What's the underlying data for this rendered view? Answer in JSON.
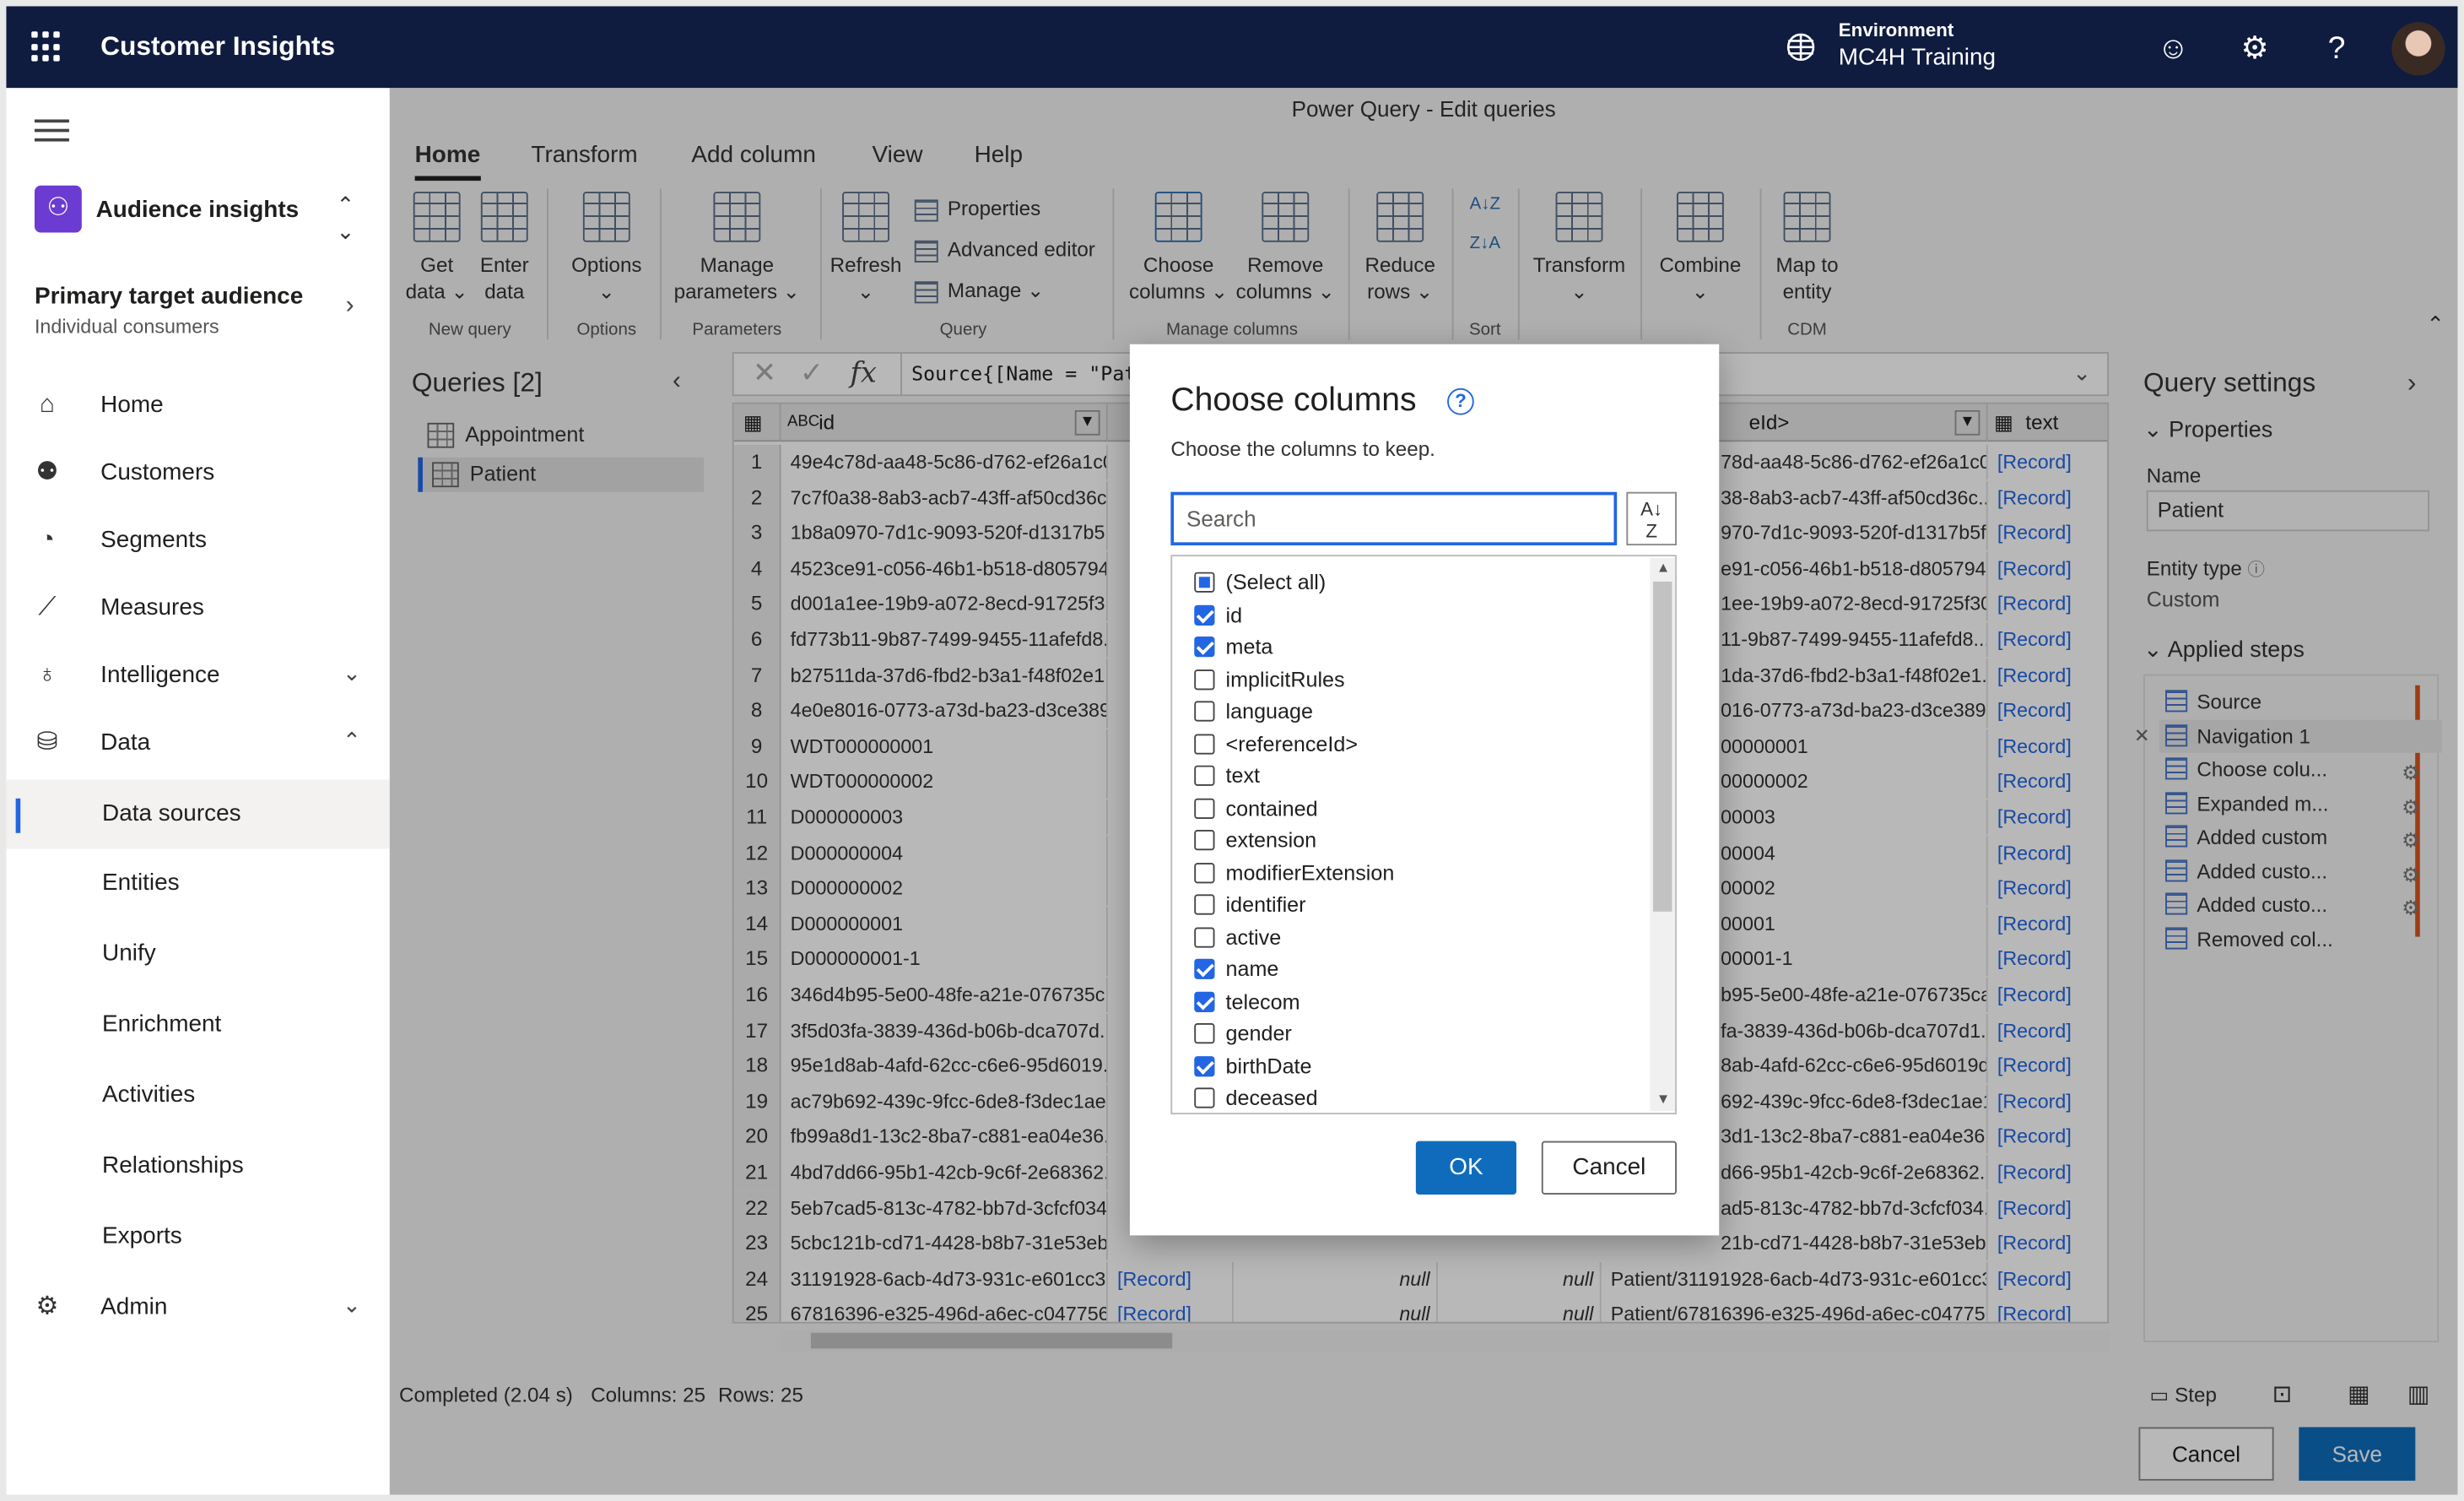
{
  "topbar": {
    "app_name": "Customer Insights",
    "env_label": "Environment",
    "env_value": "MC4H Training",
    "icons": [
      "waffle-icon",
      "environment-icon",
      "smiley-icon",
      "gear-icon",
      "help-icon",
      "avatar"
    ]
  },
  "sidebar": {
    "app": "Audience insights",
    "audience_title": "Primary target audience",
    "audience_sub": "Individual consumers",
    "items": [
      {
        "label": "Home",
        "icon": "home-icon"
      },
      {
        "label": "Customers",
        "icon": "customers-icon"
      },
      {
        "label": "Segments",
        "icon": "segments-icon"
      },
      {
        "label": "Measures",
        "icon": "measures-icon"
      },
      {
        "label": "Intelligence",
        "icon": "bulb-icon"
      },
      {
        "label": "Data",
        "icon": "data-icon"
      }
    ],
    "subitems": [
      "Data sources",
      "Entities",
      "Unify",
      "Enrichment",
      "Activities",
      "Relationships",
      "Exports"
    ],
    "admin": "Admin"
  },
  "pq": {
    "title": "Power Query - Edit queries",
    "tabs": [
      "Home",
      "Transform",
      "Add column",
      "View",
      "Help"
    ],
    "ribbon": {
      "get_data": [
        "Get",
        "data"
      ],
      "enter_data": [
        "Enter",
        "data"
      ],
      "new_query": "New query",
      "options": "Options",
      "options_grp": "Options",
      "manage_params": [
        "Manage",
        "parameters"
      ],
      "params_grp": "Parameters",
      "refresh": "Refresh",
      "properties": "Properties",
      "advanced_editor": "Advanced editor",
      "manage": "Manage",
      "query_grp": "Query",
      "choose_columns": [
        "Choose",
        "columns"
      ],
      "remove_columns": [
        "Remove",
        "columns"
      ],
      "manage_cols_grp": "Manage columns",
      "reduce_rows": [
        "Reduce",
        "rows"
      ],
      "sort_grp": "Sort",
      "transform": "Transform",
      "combine": "Combine",
      "map_entity": [
        "Map to",
        "entity"
      ],
      "cdm_grp": "CDM"
    },
    "queries": {
      "title": "Queries [2]",
      "items": [
        "Appointment",
        "Patient"
      ]
    },
    "formula": "Source{[Name = \"Pat",
    "columns": {
      "c1": "id",
      "c2": "eId>",
      "c3": "text"
    },
    "rows": [
      [
        "1",
        "49e4c78d-aa48-5c86-d762-ef26a1c0...",
        "78d-aa48-5c86-d762-ef26a1c0...",
        "[Record]"
      ],
      [
        "2",
        "7c7f0a38-8ab3-acb7-43ff-af50cd36c...",
        "38-8ab3-acb7-43ff-af50cd36c...",
        "[Record]"
      ],
      [
        "3",
        "1b8a0970-7d1c-9093-520f-d1317b5...",
        "970-7d1c-9093-520f-d1317b5f...",
        "[Record]"
      ],
      [
        "4",
        "4523ce91-c056-46b1-b518-d805794...",
        "e91-c056-46b1-b518-d805794f...",
        "[Record]"
      ],
      [
        "5",
        "d001a1ee-19b9-a072-8ecd-91725f3...",
        "1ee-19b9-a072-8ecd-91725f30...",
        "[Record]"
      ],
      [
        "6",
        "fd773b11-9b87-7499-9455-11afefd8...",
        "11-9b87-7499-9455-11afefd8...",
        "[Record]"
      ],
      [
        "7",
        "b27511da-37d6-fbd2-b3a1-f48f02e1...",
        "1da-37d6-fbd2-b3a1-f48f02e1...",
        "[Record]"
      ],
      [
        "8",
        "4e0e8016-0773-a73d-ba23-d3ce389...",
        "016-0773-a73d-ba23-d3ce389...",
        "[Record]"
      ],
      [
        "9",
        "WDT000000001",
        "00000001",
        "[Record]"
      ],
      [
        "10",
        "WDT000000002",
        "00000002",
        "[Record]"
      ],
      [
        "11",
        "D000000003",
        "00003",
        "[Record]"
      ],
      [
        "12",
        "D000000004",
        "00004",
        "[Record]"
      ],
      [
        "13",
        "D000000002",
        "00002",
        "[Record]"
      ],
      [
        "14",
        "D000000001",
        "00001",
        "[Record]"
      ],
      [
        "15",
        "D000000001-1",
        "00001-1",
        "[Record]"
      ],
      [
        "16",
        "346d4b95-5e00-48fe-a21e-076735c...",
        "b95-5e00-48fe-a21e-076735ca...",
        "[Record]"
      ],
      [
        "17",
        "3f5d03fa-3839-436d-b06b-dca707d...",
        "fa-3839-436d-b06b-dca707d1...",
        "[Record]"
      ],
      [
        "18",
        "95e1d8ab-4afd-62cc-c6e6-95d6019...",
        "8ab-4afd-62cc-c6e6-95d6019d...",
        "[Record]"
      ],
      [
        "19",
        "ac79b692-439c-9fcc-6de8-f3dec1ae...",
        "692-439c-9fcc-6de8-f3dec1ae1...",
        "[Record]"
      ],
      [
        "20",
        "fb99a8d1-13c2-8ba7-c881-ea04e36...",
        "3d1-13c2-8ba7-c881-ea04e361...",
        "[Record]"
      ],
      [
        "21",
        "4bd7dd66-95b1-42cb-9c6f-2e68362...",
        "d66-95b1-42cb-9c6f-2e68362...",
        "[Record]"
      ],
      [
        "22",
        "5eb7cad5-813c-4782-bb7d-3cfcf034...",
        "ad5-813c-4782-bb7d-3cfcf034...",
        "[Record]"
      ],
      [
        "23",
        "5cbc121b-cd71-4428-b8b7-31e53eb...",
        "21b-cd71-4428-b8b7-31e53eb...",
        "[Record]"
      ]
    ],
    "rows_full": [
      [
        "24",
        "31191928-6acb-4d73-931c-e601cc3...",
        "[Record]",
        "null",
        "null",
        "Patient/31191928-6acb-4d73-931c-e601cc3a...",
        "[Record]"
      ],
      [
        "25",
        "67816396-e325-496d-a6ec-c047756...",
        "[Record]",
        "null",
        "null",
        "Patient/67816396-e325-496d-a6ec-c047756...",
        "[Record]"
      ]
    ],
    "settings": {
      "title": "Query settings",
      "properties": "Properties",
      "name_label": "Name",
      "name_value": "Patient",
      "entity_type_label": "Entity type",
      "entity_type_value": "Custom",
      "applied_steps": "Applied steps",
      "steps": [
        "Source",
        "Navigation 1",
        "Choose colu...",
        "Expanded m...",
        "Added custom",
        "Added custo...",
        "Added custo...",
        "Removed col..."
      ]
    },
    "status": {
      "completed": "Completed (2.04 s)",
      "columns": "Columns: 25",
      "rows": "Rows: 25",
      "step": "Step"
    },
    "footer": {
      "cancel": "Cancel",
      "save": "Save"
    }
  },
  "dialog": {
    "title": "Choose columns",
    "subtitle": "Choose the columns to keep.",
    "search_placeholder": "Search",
    "items": [
      {
        "label": "(Select all)",
        "state": "partial"
      },
      {
        "label": "id",
        "state": "on"
      },
      {
        "label": "meta",
        "state": "on"
      },
      {
        "label": "implicitRules",
        "state": "off"
      },
      {
        "label": "language",
        "state": "off"
      },
      {
        "label": "<referenceId>",
        "state": "off"
      },
      {
        "label": "text",
        "state": "off"
      },
      {
        "label": "contained",
        "state": "off"
      },
      {
        "label": "extension",
        "state": "off"
      },
      {
        "label": "modifierExtension",
        "state": "off"
      },
      {
        "label": "identifier",
        "state": "off"
      },
      {
        "label": "active",
        "state": "off"
      },
      {
        "label": "name",
        "state": "on"
      },
      {
        "label": "telecom",
        "state": "on"
      },
      {
        "label": "gender",
        "state": "off"
      },
      {
        "label": "birthDate",
        "state": "on"
      },
      {
        "label": "deceased",
        "state": "off"
      }
    ],
    "ok": "OK",
    "cancel": "Cancel"
  }
}
